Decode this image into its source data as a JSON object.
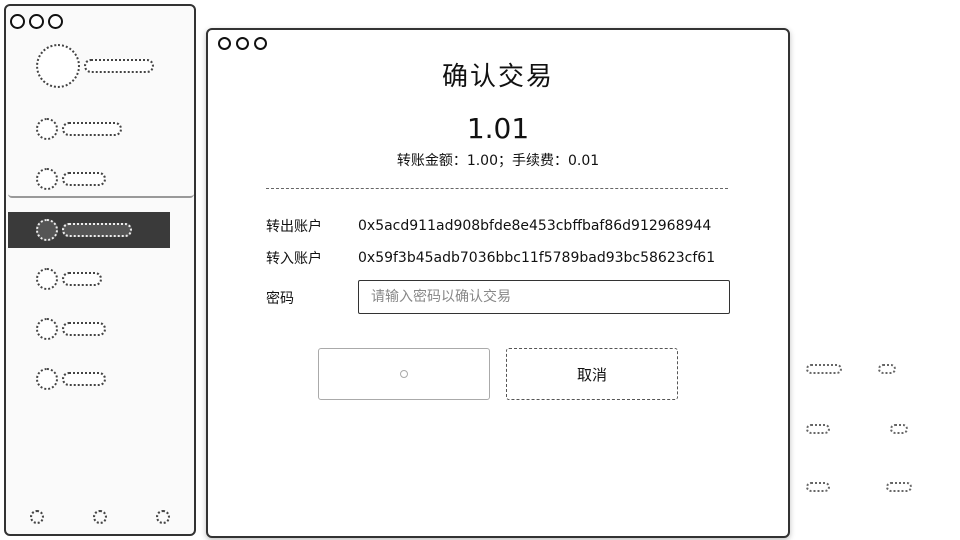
{
  "dialog": {
    "title": "确认交易",
    "amount": "1.01",
    "breakdown": "转账金额：1.00；手续费：0.01",
    "from_label": "转出账户",
    "from_address": "0x5acd911ad908bfde8e453cbffbaf86d912968944",
    "to_label": "转入账户",
    "to_address": "0x59f3b45adb7036bbc11f5789bad93bc58623cf61",
    "password_label": "密码",
    "password_placeholder": "请输入密码以确认交易",
    "cancel_label": "取消"
  }
}
